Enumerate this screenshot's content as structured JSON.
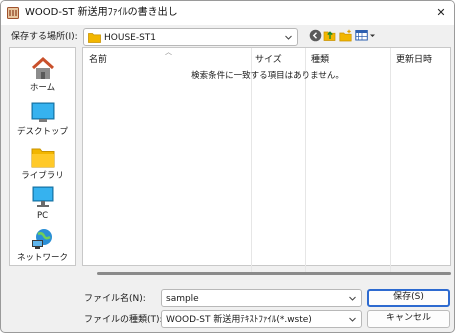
{
  "window": {
    "title": "WOOD-ST 新送用ﾌｧｲﾙの書き出し",
    "close_glyph": "✕"
  },
  "location": {
    "label": "保存する場所(I):",
    "value": "HOUSE-ST1"
  },
  "toolbar": {
    "icons": [
      "back-icon",
      "up-folder-icon",
      "new-folder-icon",
      "view-menu-icon"
    ]
  },
  "places": [
    {
      "id": "home",
      "label": "ホーム",
      "icon": "home-icon"
    },
    {
      "id": "desktop",
      "label": "デスクトップ",
      "icon": "desktop-icon"
    },
    {
      "id": "library",
      "label": "ライブラリ",
      "icon": "library-folder-icon"
    },
    {
      "id": "pc",
      "label": "PC",
      "icon": "pc-icon"
    },
    {
      "id": "network",
      "label": "ネットワーク",
      "icon": "network-icon"
    }
  ],
  "file_list": {
    "columns": [
      "名前",
      "サイズ",
      "種類",
      "更新日時"
    ],
    "empty_message": "検索条件に一致する項目はありません。"
  },
  "filename": {
    "label": "ファイル名(N):",
    "value": "sample"
  },
  "filetype": {
    "label": "ファイルの種類(T):",
    "value": "WOOD-ST 新送用ﾃｷｽﾄﾌｧｲﾙ(*.wste)"
  },
  "buttons": {
    "save": "保存(S)",
    "cancel": "キャンセル"
  },
  "colors": {
    "accent": "#2d6ad0",
    "folder": "#f2b600"
  }
}
